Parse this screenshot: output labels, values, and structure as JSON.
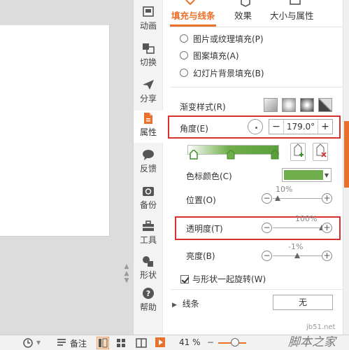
{
  "vertical_tabs": [
    {
      "label": "动画",
      "icon": "animation-icon"
    },
    {
      "label": "切换",
      "icon": "transition-icon"
    },
    {
      "label": "分享",
      "icon": "share-icon"
    },
    {
      "label": "属性",
      "icon": "properties-icon"
    },
    {
      "label": "反馈",
      "icon": "feedback-icon"
    },
    {
      "label": "备份",
      "icon": "backup-icon"
    },
    {
      "label": "工具",
      "icon": "toolbox-icon"
    },
    {
      "label": "形状",
      "icon": "shape-icon"
    },
    {
      "label": "帮助",
      "icon": "help-icon"
    }
  ],
  "panel": {
    "tabs": [
      "填充与线条",
      "效果",
      "大小与属性"
    ],
    "fill_options": [
      "图片或纹理填充(P)",
      "图案填充(A)",
      "幻灯片背景填充(B)"
    ],
    "gradient_style_label": "渐变样式(R)",
    "angle_label": "角度(E)",
    "angle_value": "179.0°",
    "stop_color_label": "色标颜色(C)",
    "stop_color": "#6fae4a",
    "position_label": "位置(O)",
    "position_value": "10%",
    "position_fraction": 0.1,
    "transparency_label": "透明度(T)",
    "transparency_value": "100%",
    "transparency_fraction": 1.0,
    "brightness_label": "亮度(B)",
    "brightness_value": "-1%",
    "brightness_fraction": 0.495,
    "rotate_with_shape_label": "与形状一起旋转(W)",
    "rotate_with_shape_checked": true,
    "line_label": "线条",
    "line_value": "无",
    "accent_color": "#e8712b"
  },
  "statusbar": {
    "notes_label": "备注",
    "zoom": "41 %"
  },
  "watermark": {
    "site": "jb51.net",
    "brand": "脚本之家"
  }
}
